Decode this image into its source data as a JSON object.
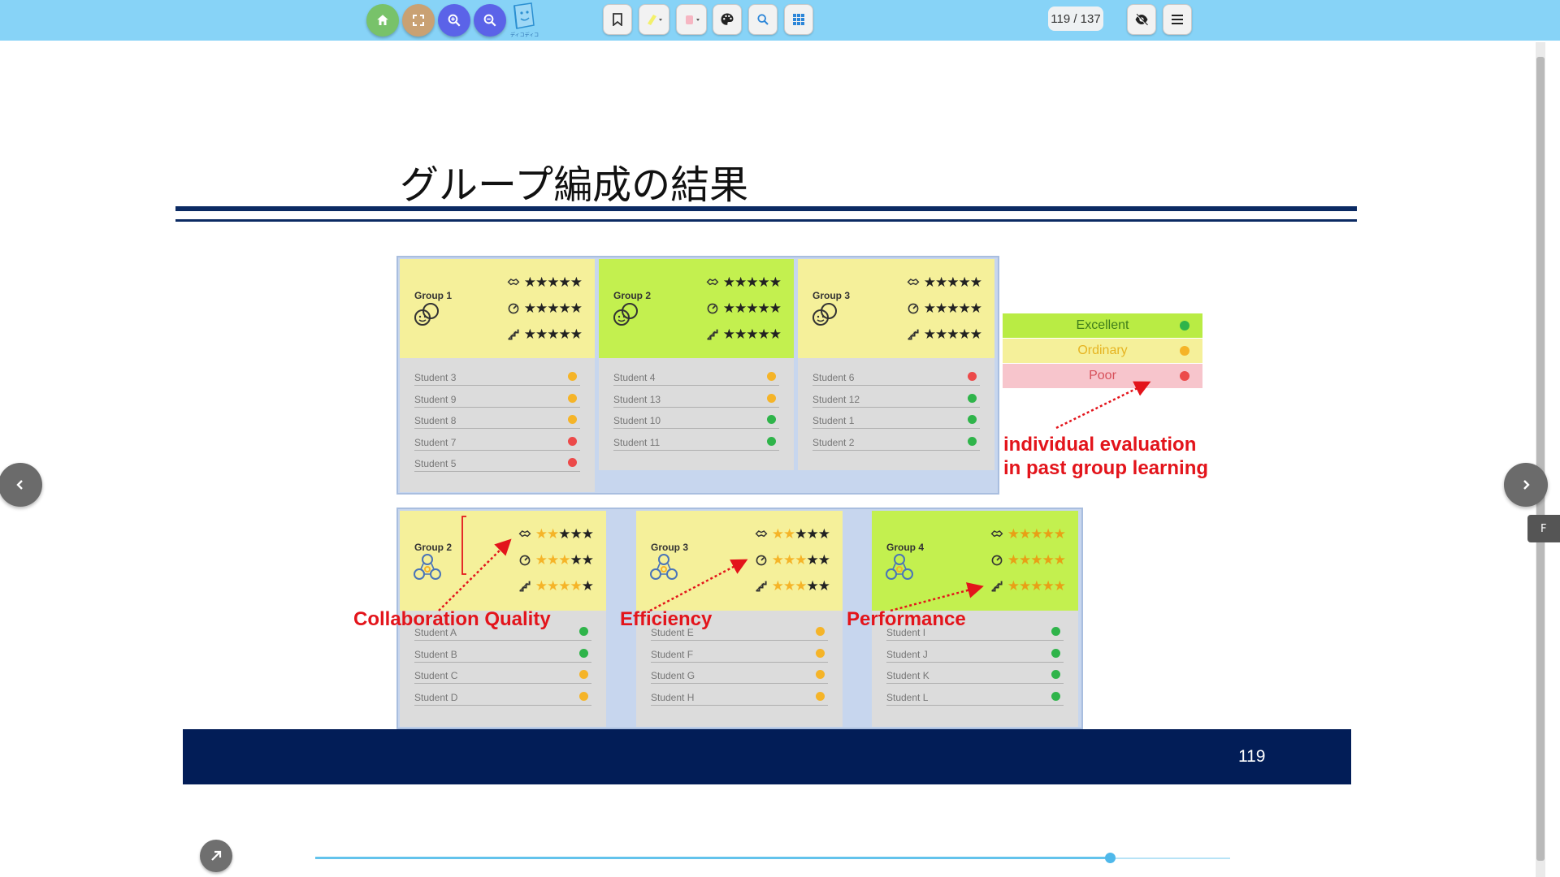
{
  "toolbar": {
    "left_buttons": [
      {
        "name": "home-icon",
        "color": "#78c26a"
      },
      {
        "name": "fullscreen-icon",
        "color": "#c9a173"
      },
      {
        "name": "zoom-in-icon",
        "color": "#5b63e8"
      },
      {
        "name": "zoom-out-icon",
        "color": "#5b63e8"
      }
    ],
    "logo_caption": "ディコディコ",
    "page_counter": "119 / 137",
    "bg_color": "#87d3f7"
  },
  "slide": {
    "title": "グループ編成の結果",
    "footer_page": "119",
    "footer_color": "#021d57"
  },
  "top_groups": [
    {
      "name": "Group 1",
      "students": [
        {
          "name": "Student 3",
          "status": "ordinary"
        },
        {
          "name": "Student 9",
          "status": "ordinary"
        },
        {
          "name": "Student 8",
          "status": "ordinary"
        },
        {
          "name": "Student 7",
          "status": "poor"
        },
        {
          "name": "Student 5",
          "status": "poor"
        }
      ]
    },
    {
      "name": "Group 2",
      "students": [
        {
          "name": "Student 4",
          "status": "ordinary"
        },
        {
          "name": "Student 13",
          "status": "ordinary"
        },
        {
          "name": "Student 10",
          "status": "excellent"
        },
        {
          "name": "Student 11",
          "status": "excellent"
        }
      ]
    },
    {
      "name": "Group 3",
      "students": [
        {
          "name": "Student 6",
          "status": "poor"
        },
        {
          "name": "Student 12",
          "status": "excellent"
        },
        {
          "name": "Student 1",
          "status": "excellent"
        },
        {
          "name": "Student 2",
          "status": "excellent"
        }
      ]
    }
  ],
  "bottom_groups": [
    {
      "name": "Group 2",
      "ratings": {
        "collaboration": 2,
        "efficiency": 3,
        "performance": 4
      },
      "students": [
        {
          "name": "Student A",
          "status": "excellent"
        },
        {
          "name": "Student B",
          "status": "excellent"
        },
        {
          "name": "Student C",
          "status": "ordinary"
        },
        {
          "name": "Student D",
          "status": "ordinary"
        }
      ]
    },
    {
      "name": "Group 3",
      "ratings": {
        "collaboration": 2,
        "efficiency": 3,
        "performance": 3
      },
      "students": [
        {
          "name": "Student E",
          "status": "ordinary"
        },
        {
          "name": "Student F",
          "status": "ordinary"
        },
        {
          "name": "Student G",
          "status": "ordinary"
        },
        {
          "name": "Student H",
          "status": "ordinary"
        }
      ]
    },
    {
      "name": "Group 4",
      "ratings": {
        "collaboration": 5,
        "efficiency": 5,
        "performance": 5
      },
      "students": [
        {
          "name": "Student I",
          "status": "excellent"
        },
        {
          "name": "Student J",
          "status": "excellent"
        },
        {
          "name": "Student K",
          "status": "excellent"
        },
        {
          "name": "Student L",
          "status": "excellent"
        }
      ]
    }
  ],
  "legend": [
    {
      "label": "Excellent",
      "bg": "#b9ec44",
      "fg": "#3f7d1a",
      "dot": "#2fb44a"
    },
    {
      "label": "Ordinary",
      "bg": "#f5f09a",
      "fg": "#e6b422",
      "dot": "#f5b428"
    },
    {
      "label": "Poor",
      "bg": "#f7c5cc",
      "fg": "#d7505a",
      "dot": "#ec4a4a"
    }
  ],
  "annotations": {
    "legend_note_line1": "individual evaluation",
    "legend_note_line2": "in past group learning",
    "collaboration": "Collaboration Quality",
    "efficiency": "Efficiency",
    "performance": "Performance"
  },
  "colors": {
    "excellent": "#2fb44a",
    "ordinary": "#f5b428",
    "poor": "#ec4a4a",
    "annotation": "#e3141b"
  },
  "progress": {
    "current_page": 119,
    "total_pages": 137
  }
}
